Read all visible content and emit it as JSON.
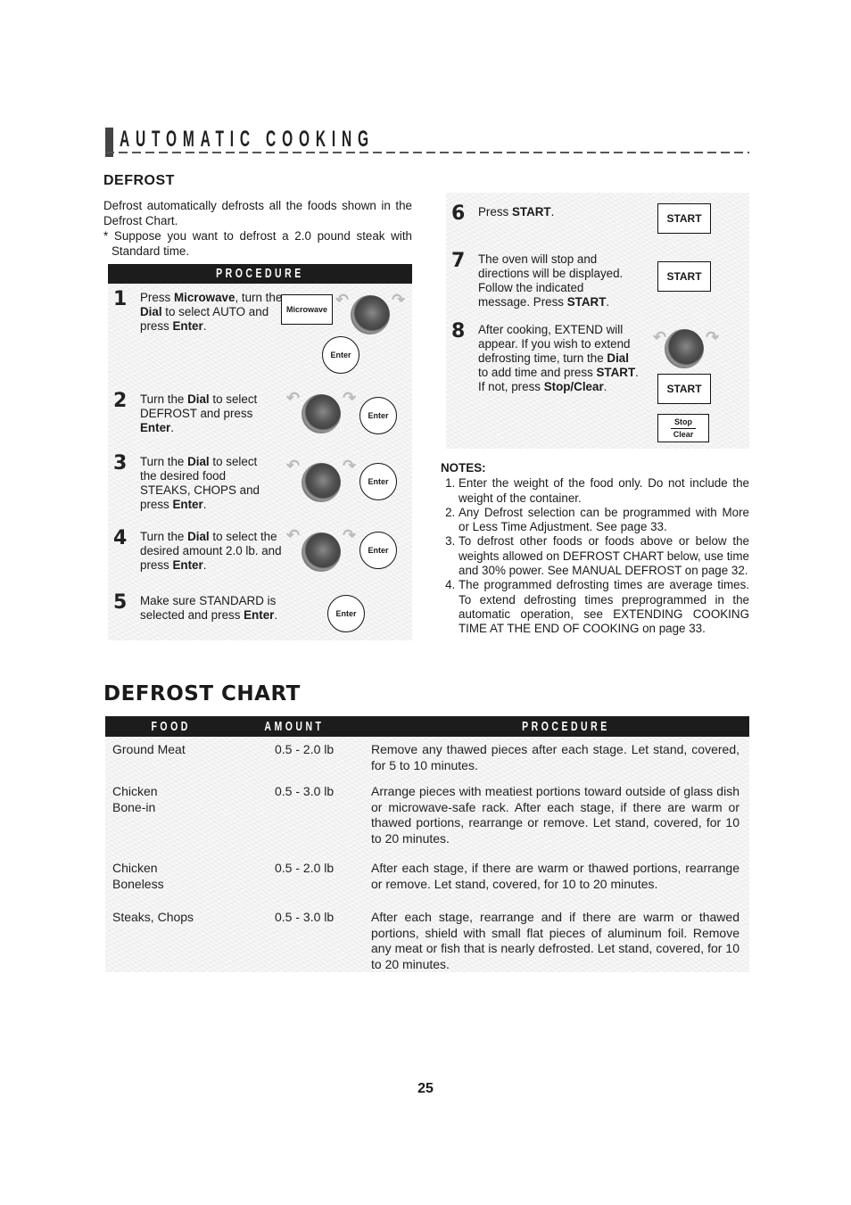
{
  "header": {
    "section_title": "AUTOMATIC COOKING"
  },
  "defrost": {
    "title": "DEFROST",
    "intro": "Defrost automatically defrosts all the foods shown in the Defrost Chart.",
    "example": "* Suppose you want to defrost a 2.0 pound steak with Standard time.",
    "procedure_label": "PROCEDURE",
    "steps": [
      {
        "num": "1",
        "html": "Press <b>Microwave</b>, turn the <b>Dial</b> to select AUTO and press <b>Enter</b>."
      },
      {
        "num": "2",
        "html": "Turn the <b>Dial</b> to select DEFROST and press <b>Enter</b>."
      },
      {
        "num": "3",
        "html": "Turn the <b>Dial</b> to select the desired food STEAKS, CHOPS and press <b>Enter</b>."
      },
      {
        "num": "4",
        "html": "Turn the <b>Dial</b> to select the desired amount 2.0 lb. and press <b>Enter</b>."
      },
      {
        "num": "5",
        "html": "Make sure STANDARD is selected and press <b>Enter</b>."
      },
      {
        "num": "6",
        "html": "Press <b>START</b>."
      },
      {
        "num": "7",
        "html": "The oven will stop and directions will be displayed. Follow the indicated message. Press <b>START</b>."
      },
      {
        "num": "8",
        "html": "After cooking, EXTEND will appear. If you wish to extend defrosting time, turn the <b>Dial</b> to add time and press <b>START</b>. If not, press <b>Stop/Clear</b>."
      }
    ],
    "keys": {
      "microwave": "Microwave",
      "enter": "Enter",
      "start": "START",
      "stop": "Stop",
      "clear": "Clear"
    }
  },
  "notes": {
    "title": "NOTES:",
    "items": [
      "Enter the weight of the food only. Do not include the weight of the container.",
      "Any Defrost selection can be programmed with More or Less Time Adjustment. See page 33.",
      "To defrost other foods or foods above or below the weights allowed on DEFROST CHART below, use time and 30% power. See MANUAL DEFROST on page 32.",
      "The programmed defrosting times are average times. To extend defrosting times preprogrammed in the automatic operation, see EXTENDING COOKING TIME AT THE END OF COOKING on page 33."
    ]
  },
  "defrost_chart": {
    "title": "DEFROST CHART",
    "columns": [
      "FOOD",
      "AMOUNT",
      "PROCEDURE"
    ],
    "rows": [
      {
        "food": "Ground Meat",
        "amount": "0.5 - 2.0 lb",
        "procedure": "Remove any thawed pieces after each stage. Let stand, covered, for 5 to 10 minutes."
      },
      {
        "food": "Chicken Bone-in",
        "amount": "0.5 - 3.0 lb",
        "procedure": "Arrange pieces with meatiest portions toward outside of glass dish or microwave-safe rack. After each stage, if there are warm or thawed portions, rearrange or remove. Let stand, covered, for 10 to 20 minutes."
      },
      {
        "food": "Chicken Boneless",
        "amount": "0.5 - 2.0 lb",
        "procedure": "After each stage, if there are warm or thawed portions, rearrange or remove. Let stand, covered, for 10 to 20 minutes."
      },
      {
        "food": "Steaks, Chops",
        "amount": "0.5 - 3.0 lb",
        "procedure": "After each stage, rearrange and if there are warm or thawed portions, shield with small flat pieces of aluminum foil. Remove any meat or fish that is nearly defrosted. Let stand, covered, for 10 to 20 minutes."
      }
    ]
  },
  "footer": {
    "page_number": "25"
  }
}
